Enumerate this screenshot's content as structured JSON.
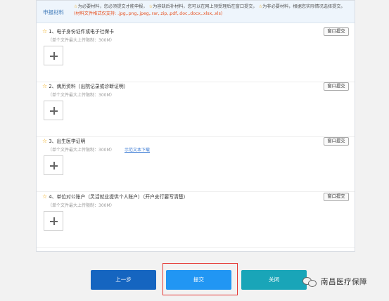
{
  "notice": {
    "title": "申报材料",
    "star1": "☆",
    "text1": "为必要材料，您必须提交才能申报，",
    "star2": "☆",
    "text2": "为容缺后补材料，您可以在网上预受理后在窗口提交，",
    "star3": "☆",
    "text3": "为非必要材料，根据您实际情况选择提交。",
    "formats": "(材料文件格式仅支持: .jpg,.png,.jpeg,.rar,.zip,.pdf,.doc,.docx,.xlsx,.xls)"
  },
  "sections": [
    {
      "star": "☆",
      "title": "1、电子身份证件或电子社保卡",
      "limit": "（单个文件最大上传限制：300M）",
      "window_btn": "窗口提交",
      "link": ""
    },
    {
      "star": "☆",
      "title": "2、病历资料（出院记录或诊断证明）",
      "limit": "（单个文件最大上传限制：300M）",
      "window_btn": "窗口提交",
      "link": ""
    },
    {
      "star": "☆",
      "title": "3、出生医学证明",
      "limit": "（单个文件最大上传限制：300M）",
      "window_btn": "窗口提交",
      "link": "示范文本下载"
    },
    {
      "star": "☆",
      "title": "4、单位对公账户（灵活就业提供个人账户）（开户支行要写清楚）",
      "limit": "（单个文件最大上传限制：300M）",
      "window_btn": "窗口提交",
      "link": ""
    }
  ],
  "footer": {
    "prev_label": "上一步",
    "submit_label": "提交",
    "close_label": "关闭"
  },
  "watermark": {
    "icon": "wechat-icon",
    "text": "南昌医疗保障"
  }
}
